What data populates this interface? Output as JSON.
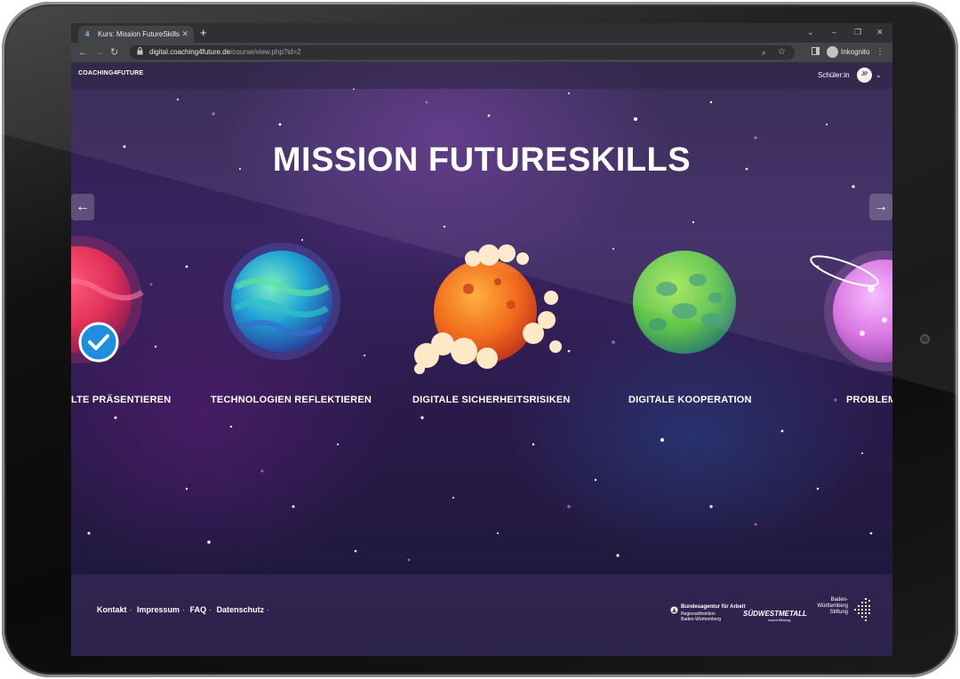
{
  "browser": {
    "tab_title": "Kurs: Mission FutureSkills",
    "tab_favicon": "4",
    "url_host": "digital.coaching4future.de",
    "url_path": "/course/view.php?id=2",
    "incognito_label": "Inkognito"
  },
  "site": {
    "logo_text": "COACHING4FUTURE",
    "role_label": "Schüler:in",
    "avatar_initials": "JP"
  },
  "main": {
    "headline": "MISSION FUTURESKILLS",
    "planets": [
      {
        "label": "LTE PRÄSENTIEREN",
        "completed": true
      },
      {
        "label": "TECHNOLOGIEN REFLEKTIEREN",
        "completed": false
      },
      {
        "label": "DIGITALE  SICHERHEITSRISIKEN",
        "completed": false
      },
      {
        "label": "DIGITALE  KOOPERATION",
        "completed": false
      },
      {
        "label": "PROBLEM",
        "completed": false
      }
    ]
  },
  "footer": {
    "links": [
      "Kontakt",
      "Impressum",
      "FAQ",
      "Datenschutz"
    ],
    "sponsors": {
      "ba_title": "Bundesagentur für Arbeit",
      "ba_sub1": "Regionaldirektion",
      "ba_sub2": "Baden-Württemberg",
      "suedwest": "SÜDWESTMETALL",
      "suedwest_sub": "macht Bildung",
      "bw_line1": "Baden-",
      "bw_line2": "Württemberg",
      "bw_line3": "Stiftung"
    }
  },
  "colors": {
    "accent_check": "#1e8fe0",
    "planet_red": "#e0305a",
    "planet_blue": "#1fa3d6",
    "planet_orange": "#f06a1c",
    "planet_green": "#5cc24a",
    "planet_pink": "#d46ae0"
  }
}
